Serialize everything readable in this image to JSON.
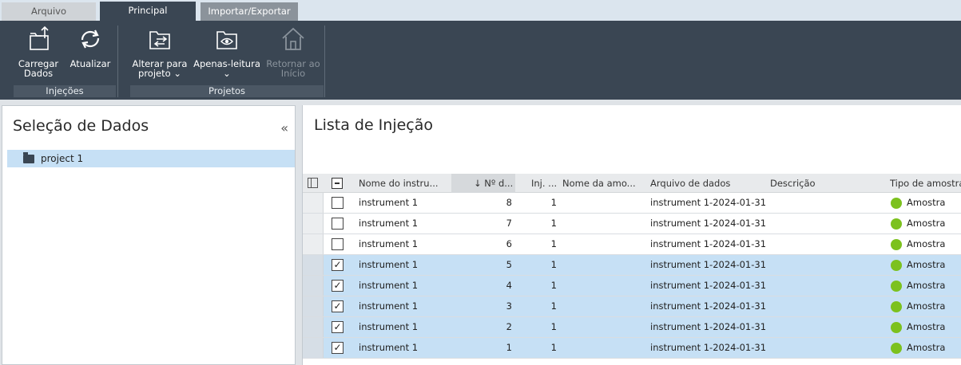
{
  "tabs": [
    {
      "label": "Arquivo"
    },
    {
      "label": "Principal"
    },
    {
      "label": "Importar/Exportar"
    }
  ],
  "ribbon": {
    "load_label_1": "Carregar",
    "load_label_2": "Dados",
    "refresh_label": "Atualizar",
    "change_project_1": "Alterar para",
    "change_project_2": "projeto",
    "readonly_label": "Apenas-leitura",
    "home_label_1": "Retornar ao",
    "home_label_2": "Início",
    "group_injections": "Injeções",
    "group_projects": "Projetos",
    "dropdown_glyph": "⌄"
  },
  "left_panel": {
    "title": "Seleção de Dados",
    "collapse_glyph": "«",
    "tree_item": "project 1"
  },
  "right_panel": {
    "title": "Lista de Injeção",
    "columns": {
      "instrument": "Nome do instru...",
      "number": "↓ Nº d...",
      "inj": "Inj. ...",
      "sample": "Nome da amo...",
      "datafile": "Arquivo de dados",
      "desc": "Descrição",
      "type": "Tipo de amostra"
    },
    "rows": [
      {
        "instrument": "instrument 1",
        "number": "8",
        "inj": "1",
        "datafile": "instrument 1-2024-01-31...",
        "type": "Amostra",
        "check": ""
      },
      {
        "instrument": "instrument 1",
        "number": "7",
        "inj": "1",
        "datafile": "instrument 1-2024-01-31...",
        "type": "Amostra",
        "check": ""
      },
      {
        "instrument": "instrument 1",
        "number": "6",
        "inj": "1",
        "datafile": "instrument 1-2024-01-31...",
        "type": "Amostra",
        "check": ""
      },
      {
        "instrument": "instrument 1",
        "number": "5",
        "inj": "1",
        "datafile": "instrument 1-2024-01-31...",
        "type": "Amostra",
        "check": "✓"
      },
      {
        "instrument": "instrument 1",
        "number": "4",
        "inj": "1",
        "datafile": "instrument 1-2024-01-31...",
        "type": "Amostra",
        "check": "✓"
      },
      {
        "instrument": "instrument 1",
        "number": "3",
        "inj": "1",
        "datafile": "instrument 1-2024-01-31...",
        "type": "Amostra",
        "check": "✓"
      },
      {
        "instrument": "instrument 1",
        "number": "2",
        "inj": "1",
        "datafile": "instrument 1-2024-01-31...",
        "type": "Amostra",
        "check": "✓"
      },
      {
        "instrument": "instrument 1",
        "number": "1",
        "inj": "1",
        "datafile": "instrument 1-2024-01-31...",
        "type": "Amostra",
        "check": "✓"
      }
    ]
  },
  "colors": {
    "ribbon": "#3a4653",
    "selection": "#c6e0f5",
    "sample_dot": "#7cc11e"
  }
}
